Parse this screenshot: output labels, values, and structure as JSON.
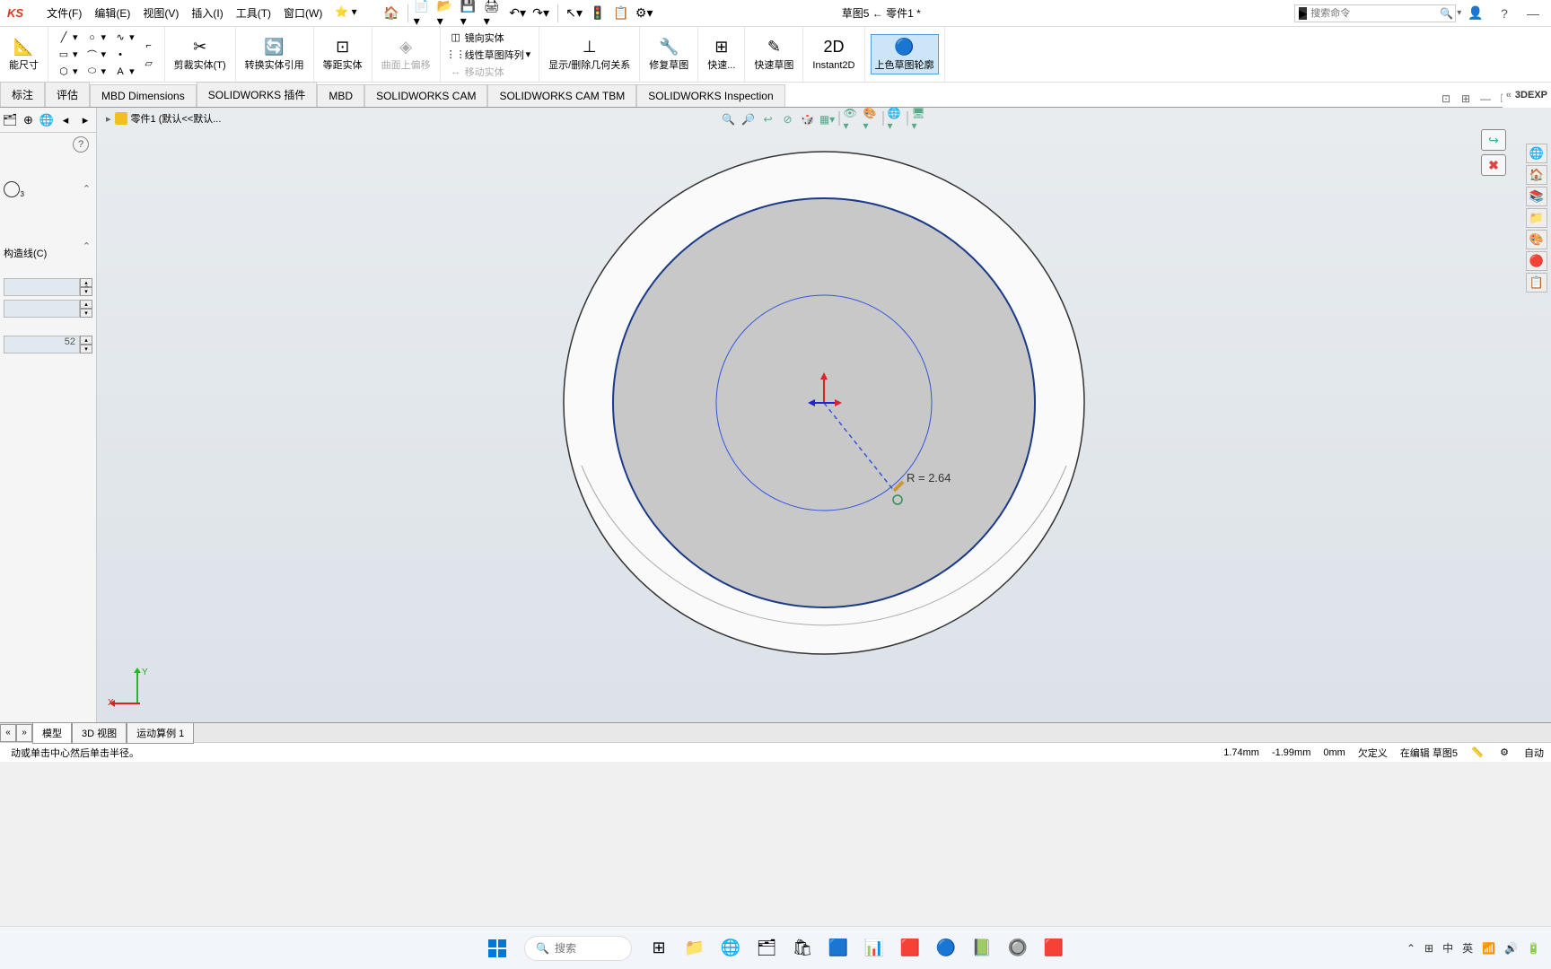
{
  "app": {
    "logo": "KS"
  },
  "menu": {
    "file": "文件(F)",
    "edit": "编辑(E)",
    "view": "视图(V)",
    "insert": "插入(I)",
    "tools": "工具(T)",
    "window": "窗口(W)"
  },
  "doc_title": "草图5 ← 零件1 *",
  "search": {
    "placeholder": "搜索命令"
  },
  "ribbon": {
    "smart_dim": "能尺寸",
    "trim": "剪裁实体(T)",
    "convert": "转换实体引用",
    "offset": "等距实体",
    "surface_offset": "曲面上偏移",
    "mirror": "镜向实体",
    "linear_pattern": "线性草图阵列",
    "move": "移动实体",
    "display_delete": "显示/删除几何关系",
    "repair": "修复草图",
    "quick_snap": "快速...",
    "rapid_sketch": "快速草图",
    "instant2d": "Instant2D",
    "shaded": "上色草图轮廓"
  },
  "tabs": {
    "annotate": "标注",
    "evaluate": "评估",
    "mbd_dim": "MBD Dimensions",
    "sw_addins": "SOLIDWORKS 插件",
    "mbd": "MBD",
    "sw_cam": "SOLIDWORKS CAM",
    "sw_cam_tbm": "SOLIDWORKS CAM TBM",
    "sw_insp": "SOLIDWORKS Inspection",
    "dexp": "3DEXP"
  },
  "breadcrumb": {
    "part": "零件1  (默认<<默认..."
  },
  "panel": {
    "construction": "构造线(C)",
    "value52": "52"
  },
  "dim_label": "R = 2.64",
  "triad": {
    "x": "X",
    "y": "Y"
  },
  "bottom_tabs": {
    "model": "模型",
    "view3d": "3D 视图",
    "motion1": "运动算例 1"
  },
  "status": {
    "msg": "动或单击中心然后单击半径。",
    "x": "1.74mm",
    "y": "-1.99mm",
    "z": "0mm",
    "under": "欠定义",
    "editing": "在编辑 草图5",
    "auto": "自动"
  },
  "taskbar": {
    "search": "搜索",
    "ime": "中",
    "ime2": "英"
  }
}
